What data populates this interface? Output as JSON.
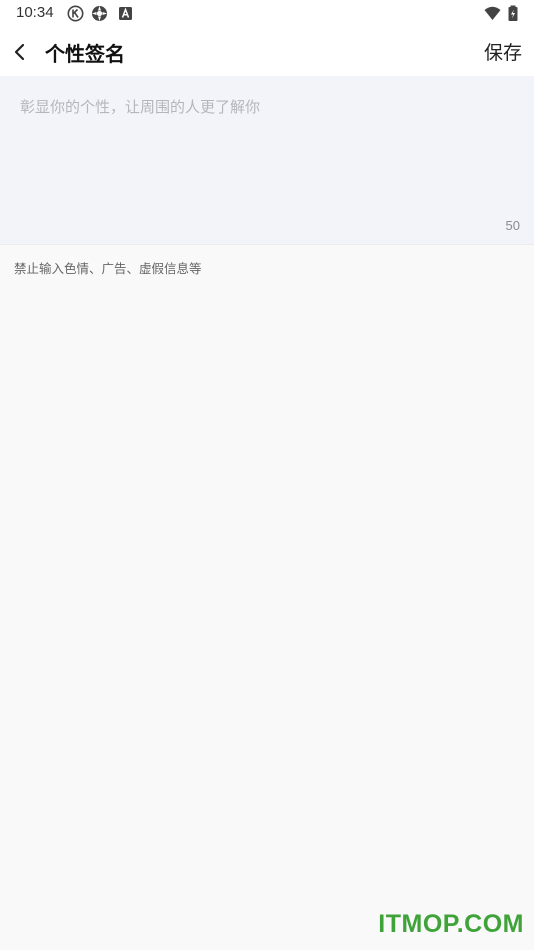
{
  "status_bar": {
    "time": "10:34",
    "icons": [
      "k-circle-icon",
      "sync-icon",
      "a-box-icon",
      "wifi-icon",
      "battery-icon"
    ]
  },
  "header": {
    "title": "个性签名",
    "save_label": "保存",
    "back_icon": "chevron-left-icon"
  },
  "signature": {
    "placeholder": "彰显你的个性，让周围的人更了解你",
    "value": "",
    "max_length": "50"
  },
  "hint": "禁止输入色情、广告、虚假信息等",
  "watermark": "ITMOP.COM",
  "colors": {
    "background": "#f9f9fa",
    "input_background": "#f3f4f9",
    "watermark": "#3fa33a"
  }
}
